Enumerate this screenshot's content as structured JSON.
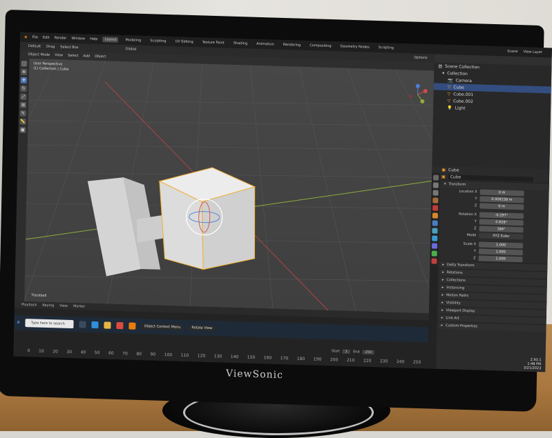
{
  "monitor": {
    "brand": "ViewSonic"
  },
  "menubar": {
    "menus": [
      "File",
      "Edit",
      "Render",
      "Window",
      "Help"
    ],
    "workspaces": [
      "Layout",
      "Modeling",
      "Sculpting",
      "UV Editing",
      "Texture Paint",
      "Shading",
      "Animation",
      "Rendering",
      "Compositing",
      "Geometry Nodes",
      "Scripting"
    ],
    "active_workspace": "Layout",
    "scene": "Scene",
    "view_layer": "View Layer"
  },
  "toolbar": {
    "mode": "Object Mode",
    "items": [
      "View",
      "Select",
      "Add",
      "Object"
    ],
    "orientation": "Default",
    "drag": "Drag",
    "select_box": "Select Box",
    "transform": "Global",
    "options": "Options"
  },
  "viewport": {
    "label_line1": "User Perspective",
    "label_line2": "(1) Collection | Cube",
    "trackball": "Trackball"
  },
  "timeline": {
    "items": [
      "Playback",
      "Keying",
      "View",
      "Marker"
    ],
    "ruler": [
      "0",
      "10",
      "20",
      "30",
      "40",
      "50",
      "60",
      "70",
      "80",
      "90",
      "100",
      "110",
      "120",
      "130",
      "140",
      "150",
      "160",
      "170",
      "180",
      "190",
      "200",
      "210",
      "220",
      "230",
      "240",
      "250"
    ],
    "start_label": "Start",
    "start": "1",
    "end_label": "End",
    "end": "250"
  },
  "taskbar": {
    "search_placeholder": "Type here to search",
    "popup1": "Object Context Menu",
    "popup2": "Rotate View"
  },
  "outliner": {
    "title": "Scene Collection",
    "collection": "Collection",
    "items": [
      {
        "name": "Camera",
        "selected": false
      },
      {
        "name": "Cube",
        "selected": true
      },
      {
        "name": "Cube.001",
        "selected": false
      },
      {
        "name": "Cube.002",
        "selected": false
      },
      {
        "name": "Light",
        "selected": false
      }
    ]
  },
  "properties": {
    "object_name": "Cube",
    "data_name": "Cube",
    "transform_section": "Transform",
    "location": {
      "label": "Location X",
      "x": "0 m",
      "y": "0.008158 m",
      "z": "0 m"
    },
    "rotation": {
      "label": "Rotation X",
      "x": "-0.297°",
      "y": "0.828°",
      "z": "184°"
    },
    "mode_label": "Mode",
    "mode": "XYZ Euler",
    "scale": {
      "label": "Scale X",
      "x": "1.000",
      "y": "1.000",
      "z": "1.000"
    },
    "axis_y": "Y",
    "axis_z": "Z",
    "sections": [
      "Delta Transform",
      "Relations",
      "Collections",
      "Instancing",
      "Motion Paths",
      "Visibility",
      "Viewport Display",
      "Line Art",
      "Custom Properties"
    ]
  },
  "tray": {
    "version": "2.93.1",
    "time": "1:48 PM",
    "date": "3/21/2023"
  },
  "colors": {
    "selected": "#334d80",
    "active_tool": "#4772b3",
    "cube_highlight": "#f0b030"
  }
}
